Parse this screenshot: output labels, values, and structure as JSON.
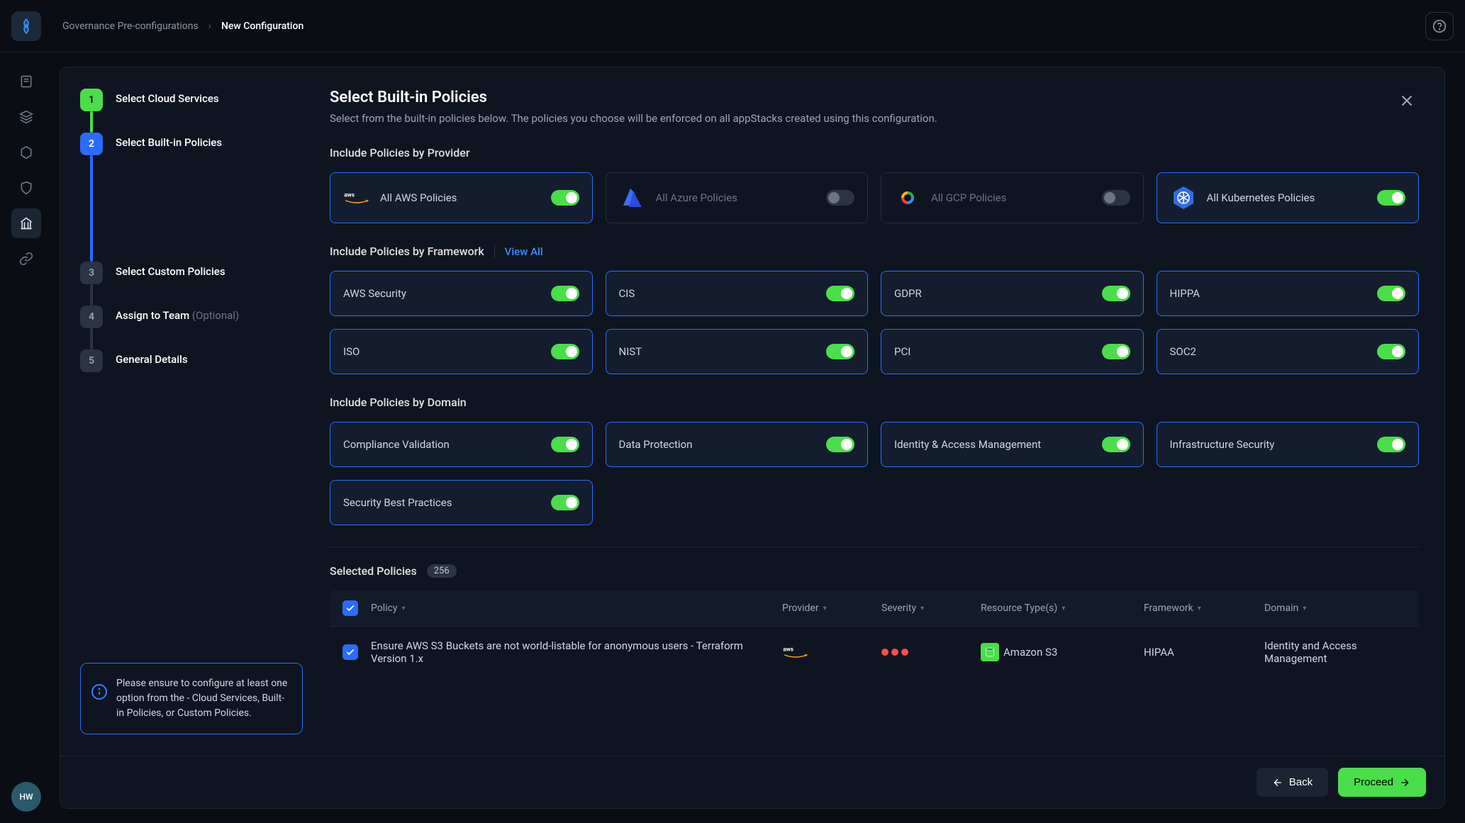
{
  "breadcrumb": {
    "prev": "Governance Pre-configurations",
    "current": "New Configuration"
  },
  "avatar": "HW",
  "stepper": {
    "steps": [
      {
        "num": "1",
        "label": "Select Cloud Services",
        "state": "done"
      },
      {
        "num": "2",
        "label": "Select Built-in Policies",
        "state": "active"
      },
      {
        "num": "3",
        "label": "Select Custom Policies",
        "state": "todo"
      },
      {
        "num": "4",
        "label": "Assign to Team",
        "optional": "(Optional)",
        "state": "todo"
      },
      {
        "num": "5",
        "label": "General Details",
        "state": "todo"
      }
    ],
    "info": "Please ensure to configure at least one option from the - Cloud Services, Built-in Policies, or Custom Policies."
  },
  "content": {
    "title": "Select Built-in Policies",
    "subtitle": "Select from the built-in policies below. The policies you choose will be enforced on all appStacks created using this configuration.",
    "provider_section": {
      "title": "Include Policies by Provider",
      "items": [
        {
          "key": "aws",
          "label": "All AWS Policies",
          "on": true
        },
        {
          "key": "azure",
          "label": "All Azure Policies",
          "on": false
        },
        {
          "key": "gcp",
          "label": "All GCP Policies",
          "on": false
        },
        {
          "key": "k8s",
          "label": "All Kubernetes Policies",
          "on": true
        }
      ]
    },
    "framework_section": {
      "title": "Include Policies by Framework",
      "view_all": "View All",
      "items": [
        {
          "label": "AWS Security",
          "on": true
        },
        {
          "label": "CIS",
          "on": true
        },
        {
          "label": "GDPR",
          "on": true
        },
        {
          "label": "HIPPA",
          "on": true
        },
        {
          "label": "ISO",
          "on": true
        },
        {
          "label": "NIST",
          "on": true
        },
        {
          "label": "PCI",
          "on": true
        },
        {
          "label": "SOC2",
          "on": true
        }
      ]
    },
    "domain_section": {
      "title": "Include Policies by Domain",
      "items": [
        {
          "label": "Compliance Validation",
          "on": true
        },
        {
          "label": "Data Protection",
          "on": true
        },
        {
          "label": "Identity & Access Management",
          "on": true
        },
        {
          "label": "Infrastructure Security",
          "on": true
        },
        {
          "label": "Security Best Practices",
          "on": true
        }
      ]
    },
    "selected": {
      "title": "Selected Policies",
      "count": "256",
      "columns": {
        "policy": "Policy",
        "provider": "Provider",
        "severity": "Severity",
        "resource": "Resource Type(s)",
        "framework": "Framework",
        "domain": "Domain"
      },
      "rows": [
        {
          "policy": "Ensure AWS S3 Buckets are not world-listable for anonymous users - Terraform Version 1.x",
          "provider": "aws",
          "severity": 3,
          "resource": "Amazon S3",
          "framework": "HIPAA",
          "domain": "Identity and Access Management"
        }
      ]
    }
  },
  "footer": {
    "back": "Back",
    "proceed": "Proceed"
  }
}
